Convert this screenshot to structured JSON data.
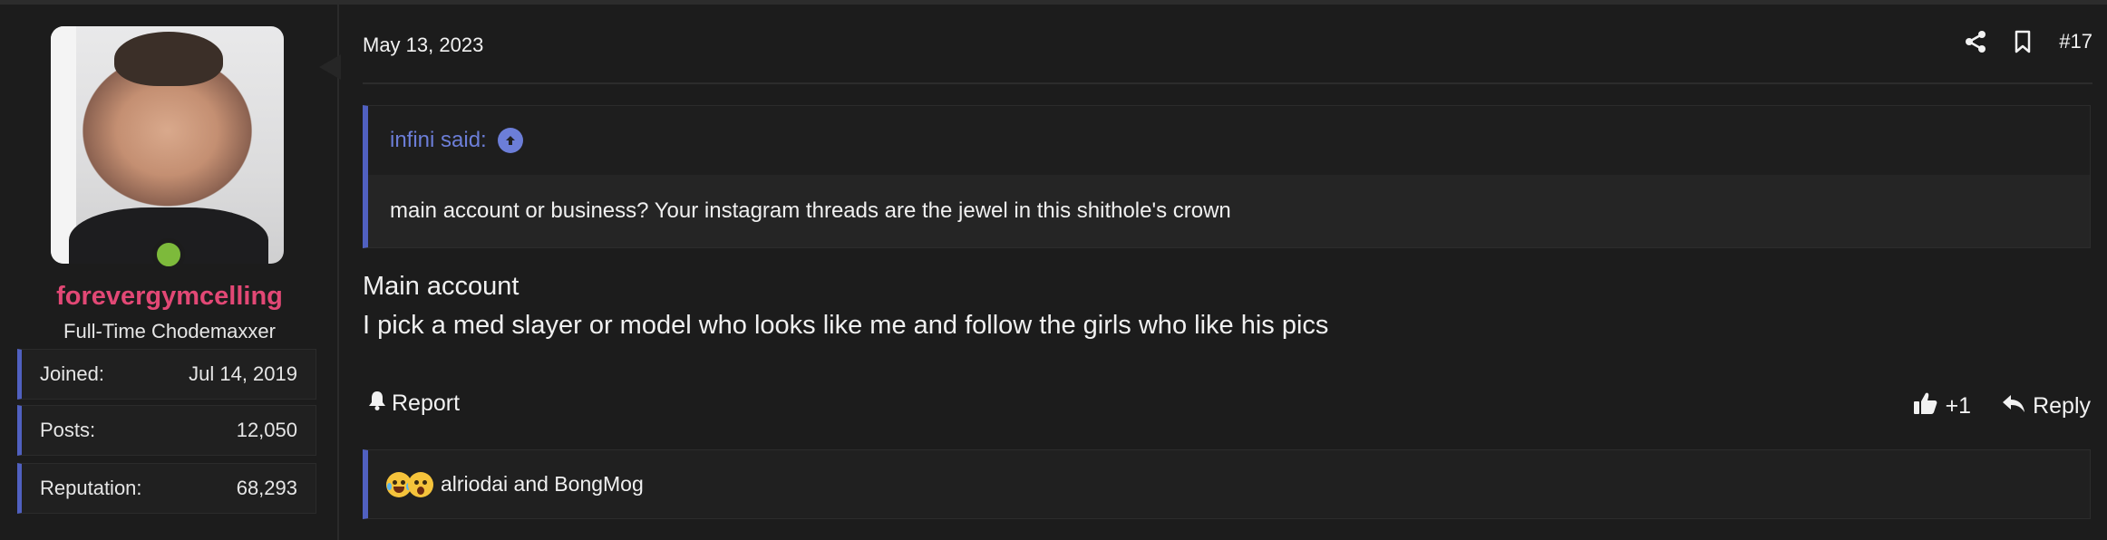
{
  "user": {
    "username": "forevergymcelling",
    "title": "Full-Time Chodemaxxer",
    "online": true,
    "stats": [
      {
        "label": "Joined:",
        "value": "Jul 14, 2019"
      },
      {
        "label": "Posts:",
        "value": "12,050"
      },
      {
        "label": "Reputation:",
        "value": "68,293"
      }
    ]
  },
  "post": {
    "date": "May 13, 2023",
    "number": "#17",
    "quote": {
      "author": "infini said:",
      "text": "main account or business? Your instagram threads are the jewel in this shithole's crown"
    },
    "message_lines": [
      "Main account",
      "I pick a med slayer or model who looks like me and follow the girls who like his pics"
    ],
    "actions": {
      "report": "Report",
      "like": "+1",
      "reply": "Reply"
    },
    "reactions": {
      "text": "alriodai and BongMog",
      "icons": [
        "crying-laughing-emoji",
        "shocked-emoji"
      ]
    }
  },
  "colors": {
    "username": "#e24875",
    "accent": "#5060c0",
    "quote_author": "#6c7ed8",
    "online": "#7dba3b"
  },
  "icons": {
    "share": "share-icon",
    "bookmark": "bookmark-icon",
    "bell": "bell-icon",
    "thumbs_up": "thumbs-up-icon",
    "reply": "reply-icon",
    "arrow_up": "arrow-up-circle-icon"
  }
}
